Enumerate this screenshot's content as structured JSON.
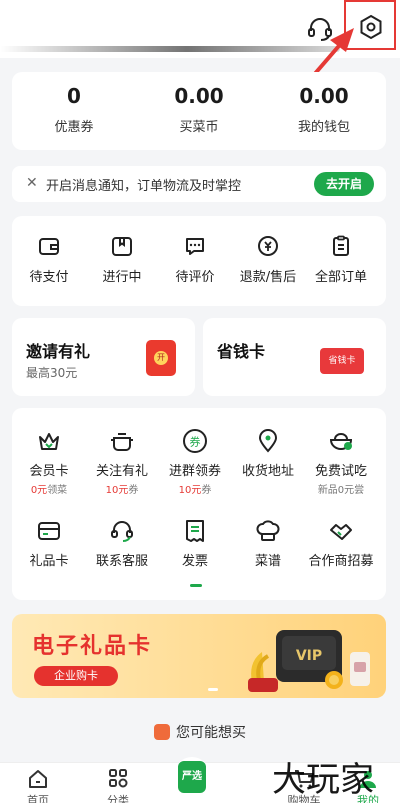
{
  "assets": [
    {
      "value": "0",
      "label": "优惠券"
    },
    {
      "value": "0.00",
      "label": "买菜币"
    },
    {
      "value": "0.00",
      "label": "我的钱包"
    }
  ],
  "notice": {
    "close": "✕",
    "text": "开启消息通知，订单物流及时掌控",
    "button": "去开启"
  },
  "orders": [
    {
      "icon": "wallet-icon",
      "label": "待支付"
    },
    {
      "icon": "package-icon",
      "label": "进行中"
    },
    {
      "icon": "comment-icon",
      "label": "待评价"
    },
    {
      "icon": "refund-icon",
      "label": "退款/售后"
    },
    {
      "icon": "clipboard-icon",
      "label": "全部订单"
    }
  ],
  "promos": {
    "invite": {
      "title": "邀请有礼",
      "sub": "最高30元",
      "badge": "开"
    },
    "save": {
      "title": "省钱卡",
      "badge": "省钱卡"
    }
  },
  "tools": [
    {
      "icon": "crown-icon",
      "label": "会员卡",
      "sub_num": "0元",
      "sub_text": "领菜"
    },
    {
      "icon": "pot-icon",
      "label": "关注有礼",
      "sub_num": "10元",
      "sub_text": "券"
    },
    {
      "icon": "coupon-icon",
      "label": "进群领券",
      "sub_num": "10元",
      "sub_text": "券",
      "badge": "券"
    },
    {
      "icon": "location-icon",
      "label": "收货地址"
    },
    {
      "icon": "bowl-icon",
      "label": "免费试吃",
      "sub_text": "新品0元尝"
    },
    {
      "icon": "gift-card-icon",
      "label": "礼品卡"
    },
    {
      "icon": "headset-icon",
      "label": "联系客服"
    },
    {
      "icon": "invoice-icon",
      "label": "发票"
    },
    {
      "icon": "chef-hat-icon",
      "label": "菜谱"
    },
    {
      "icon": "handshake-icon",
      "label": "合作商招募"
    }
  ],
  "banner": {
    "title": "电子礼品卡",
    "button": "企业购卡",
    "badge": "VIP"
  },
  "maybe": {
    "title": "您可能想买"
  },
  "tabbar": [
    {
      "icon": "home-icon",
      "label": "首页"
    },
    {
      "icon": "category-icon",
      "label": "分类"
    },
    {
      "icon": "cart-icon",
      "label": "购物车"
    },
    {
      "icon": "user-icon",
      "label": "我的"
    }
  ],
  "center_tab_badge": "严选",
  "watermark": "大玩家",
  "colors": {
    "accent": "#1ea84b",
    "red": "#e53935"
  }
}
